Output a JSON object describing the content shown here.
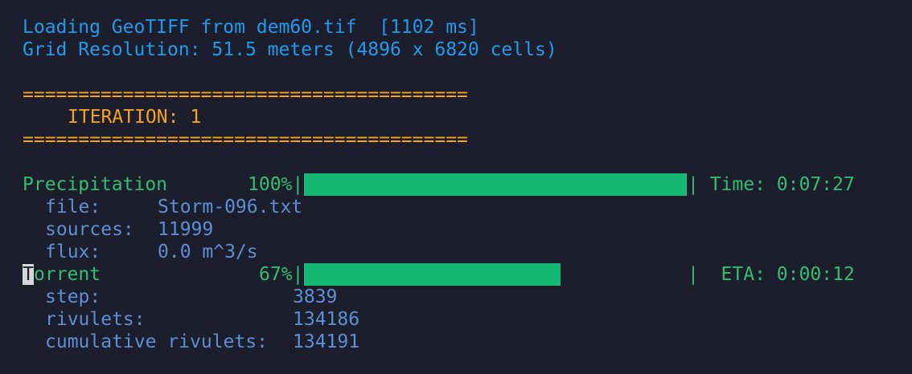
{
  "header": {
    "loading": "Loading GeoTIFF from dem60.tif  [1102 ms]",
    "grid": "Grid Resolution: 51.5 meters (4896 x 6820 cells)"
  },
  "iteration": {
    "rule": "========================================",
    "label": "ITERATION: 1"
  },
  "precipitation": {
    "name": "Precipitation",
    "percent_text": "100%|",
    "progress": 1.0,
    "tail": "| Time: 0:07:27",
    "file_label": "file:",
    "file_value": "Storm-096.txt",
    "sources_label": "sources:",
    "sources_value": "11999",
    "flux_label": "flux:",
    "flux_value": "0.0 m^3/s"
  },
  "torrent": {
    "cursor_char": "T",
    "name_rest": "orrent",
    "percent_text": "67%|",
    "progress": 0.67,
    "tail": "|  ETA: 0:00:12",
    "step_label": "step:",
    "step_value": "3839",
    "rivulets_label": "rivulets:",
    "rivulets_value": "134186",
    "cumulative_label": "cumulative rivulets:",
    "cumulative_value": "134191"
  },
  "colors": {
    "background": "#1c1f2b",
    "blue": "#1e9bf0",
    "orange": "#f5a31a",
    "green": "#2fbf71",
    "steel": "#5b8fd8",
    "bar": "#13b873"
  }
}
